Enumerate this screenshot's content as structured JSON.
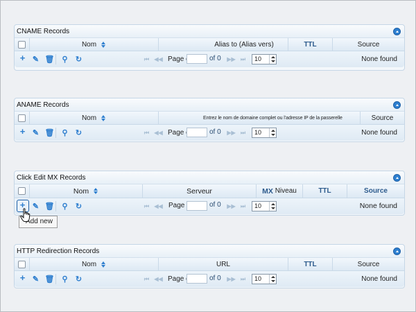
{
  "cname": {
    "title": "CNAME Records",
    "columns": [
      "Nom",
      "Alias to (Alias vers)",
      "TTL",
      "Source"
    ],
    "page_label": "Page o",
    "of_label": "of 0",
    "page_size": "10",
    "status": "None found"
  },
  "aname": {
    "title": "ANAME Records",
    "columns": [
      "Nom",
      "Entrez le nom de domaine complet ou l’adresse IP de la passerelle",
      "TTL",
      "Source"
    ],
    "page_label": "Page o",
    "of_label": "of 0",
    "page_size": "10",
    "status": "None found"
  },
  "mx": {
    "title": "Click Edit MX Records",
    "columns": [
      "Nom",
      "Serveur",
      "MX",
      "Niveau",
      "TTL",
      "Source"
    ],
    "page_label": "Page o",
    "of_label": "of 0",
    "page_size": "10",
    "status": "None found"
  },
  "http": {
    "title": "HTTP Redirection Records",
    "columns": [
      "Nom",
      "URL",
      "TTL",
      "Source"
    ],
    "page_label": "Page o",
    "of_label": "of 0",
    "page_size": "10",
    "status": "None found"
  },
  "tooltip": "Add new",
  "icons": {
    "add": "plus-icon",
    "edit": "pencil-icon",
    "delete": "trash-icon",
    "search": "magnifier-icon",
    "refresh": "refresh-icon",
    "collapse": "chevron-up-icon"
  }
}
